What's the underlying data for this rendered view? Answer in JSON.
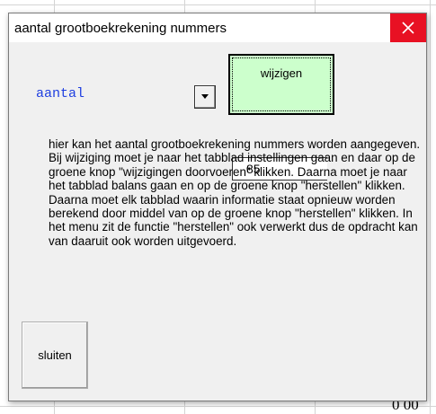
{
  "dialog": {
    "title": "aantal grootboekrekening nummers",
    "close_icon": "close-icon"
  },
  "form": {
    "aantal_label": "aantal",
    "aantal_value": "85",
    "dropdown_icon": "chevron-down-icon",
    "wijzigen_label": "wijzigen",
    "description": "hier kan het aantal grootboekrekening nummers worden aangegeven. Bij wijziging moet je naar het tabblad instellingen gaan en daar op de groene knop \"wijzigingen doorvoeren\" klikken. Daarna moet je naar het tabblad balans gaan en op de groene knop \"herstellen\" klikken. Daarna moet elk tabblad waarin informatie staat opnieuw worden berekend door middel van op de groene knop \"herstellen\" klikken. In het menu zit de functie \"herstellen\" ook verwerkt dus de opdracht kan van daaruit ook worden uitgevoerd.",
    "sluiten_label": "sluiten"
  },
  "background": {
    "cell_text": "0 00"
  },
  "colors": {
    "close_bg": "#e81123",
    "aantal_label": "#1f3fe0",
    "wijzigen_bg": "#ccffcc",
    "dialog_bg": "#f0f0f0"
  }
}
